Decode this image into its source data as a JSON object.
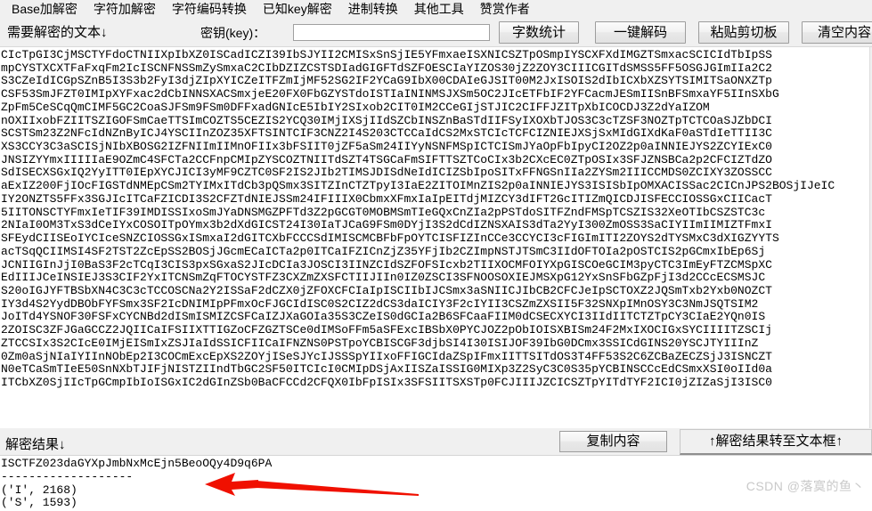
{
  "menubar": {
    "items": [
      {
        "label": "Base加解密"
      },
      {
        "label": "字符加解密"
      },
      {
        "label": "字符编码转换"
      },
      {
        "label": "已知key解密"
      },
      {
        "label": "进制转换"
      },
      {
        "label": "其他工具"
      },
      {
        "label": "赞赏作者"
      }
    ]
  },
  "toolbar": {
    "source_label": "需要解密的文本↓",
    "key_label": "密钥(key)：",
    "key_value": "",
    "key_placeholder": "",
    "count_button": "字数统计",
    "decode_button": "一键解码",
    "paste_button": "粘贴剪切板",
    "clear_button": "清空内容"
  },
  "source_text": {
    "lines": [
      "CIcTpGI3CjMSCTYFdoCTNIIXpIbXZ0ISCadICZI39IbSJYII2CMISxSnSjIE5YFmxaeISXNICSZTpOSmpIYSCXFXdIMGZTSmxacSCICIdTbIpSS",
      "mpCYSTXCXTFaFxqFm2IcISCNFNSSmZySmxaC2CIbDZIZCSTSDIadGIGFTdSZFOESCIaYIZOS30jZ2ZOY3CIIICGITdSMSS5FF5OSGJGImIIa2C2",
      "S3CZeIdICGpSZnB5I3S3b2FyI3djZIpXYICZeITFZmIjMF52SG2IF2YCaG9IbX00CDAIeGJSIT00M2JxISOIS2dIbICXbXZSYTSIMITSaONXZTp",
      "CSF53SmJFZT0IMIpXYFxac2dCbINNSXACSmxjeE20FX0FbGZYSTdoISTIaININMSJXSm5OC2JIcETFbIF2YFCacmJESmIISnBFSmxaYF5IInSXbG",
      "ZpFm5CeSCqQmCIMF5GC2CoaSJFSm9FSm0DFFxadGNIcE5IbIY2SIxob2CIT0IM2CCeGIjSTJIC2CIFFJZITpXbICOCDJ3Z2dYaIZOM",
      "nOXIIxobFZIITSZIGOFSmCaeTTSImCOZTS5CEZIS2YCQ30IMjIXSjIIdSZCbINSZnBaSTdIIFSyIXOXbTJOS3C3cTZSF3NOZTpTCTCOaSJZbDCI",
      "SCSTSm23Z2NFcIdNZnByICJ4YSCIInZOZ35XFTSINTCIF3CNZ2I4S203CTCCaIdCS2MxSTCIcTCFCIZNIEJXSjSxMIdGIXdKaF0aSTdIeTTII3C",
      "XS3CCY3C3aSCISjNIbXBOSG2IZFNIImIIMnOFIIx3bFSIIT0jZF5aSm24IIYyNSNFMSpICTCISmJYaOpFbIpyCI2OZ2p0aINNIEJYS2ZCYIExC0",
      "JNSIZYYmxIIIIIaE9OZmC4SFCTa2CCFnpCMIpZYSCOZTNIITdSZT4TSGCaFmSIFTTSZTCoCIx3b2CXcEC0ZTpOSIx3SFJZNSBCa2p2CFCIZTdZO",
      "SdISECXSGxIQ2YyITT0IEpXYCJICI3yMF9CZTC0SF2IS2JIb2TIMSJDISdNeIdICIZSbIpoSITxFFNGSnIIa2ZYSm2IIICCMDS0ZCIXY3ZOSSCC",
      "aExIZ200FjIOcFIGSTdNMEpCSm2TYIMxITdCb3pQSmx3SITZInCTZTpyI3IaE2ZITOIMnZIS2p0aINNIEJYS3ISISbIpOMXACISSac2CICnJPS2BOSjIJeIC",
      "IY2ONZTS5FFx3SGJIcITCaFZICDI3S2CFZTdNIEJSSm24IFIIIX0CbmxXFmxIaIpEITdjMIZCY3dIFT2GcITIZmQICDJISFECCIOSSGxCIICacT",
      "5IITONSCTYFmxIeTIF39IMDISSIxoSmJYaDNSMGZPFTd3Z2pGCGT0MOBMSmTIeGQxCnZIa2pPSTdoSITFZndFMSpTCSZIS32XeOTIbCSZSTC3c",
      "2NIaI0OM3TxS3dCeIYxCOSOITpOYmx3b2dXdGICST24I30IaTJCaG9FSm0DYjI3S2dCdIZNSXAIS3dTa2YyI300ZmOSS3SaCIYIImIIMIZTFmxI",
      "SFEydCIISEoIYCIceSNZCIOSSGxISmxaI2dGITCXbFCCCSdIMISCMCBFbFpOYTCISFIZInCCe3CCYCI3cFIGImITI2ZOYS2dTYSMxC3dXIGZYYTS",
      "acTSqQCIIMSI4SF2TST2ZcEpSS2BOSjJGcmECaICTa2p0ITCaIFZICnZjZ35YFjIb2CZImpNSTJTSmC3IIdOFTOIa2pOSTCIS2pGCmxIbEp6Sj",
      "JCNIIGInJjI0BaS3F2cTCqI3CIS3pxSGxaS2JIcDCIa3JOSCI3IINZCIdSZFOFSIcxb2TIIXOCMFOIYXpGISCOeGCIM3pyCTC3ImEyFTZCMSpXC",
      "EdIIIJCeINSIEJ3S3CIF2YxITCNSmZqFTOCYSTFZ3CXZmZXSFCTIIJIIn0IZ0ZSCI3SFNOOSOXIEJMSXpG12YxSnSFbGZpFjI3d2CCcECSMSJC",
      "S20oIGJYFTBSbXN4C3C3cTCCOSCNa2Y2ISSaF2dCZX0jZFOXCFCIaIpISCIIbIJCSmx3aSNIICJIbCB2CFCJeIpSCTOXZ2JQSmTxb2Yxb0NOZCT",
      "IY3d4S2YydDBObFYFSmx3SF2IcDNIMIpPFmxOcFJGCIdISC0S2CIZ2dCS3daICIY3F2cIYII3CSZmZXSII5F32SNXpIMnOSY3C3NmJSQTSIM2",
      "JoITd4YSNOF30FSFxCYCNBd2dISmISMIZCSFCaIZJXaGOIa35S3CZeIS0dGCIa2B6SFCaaFIIM0dCSECXYCI3IIdIITCTZTpCY3CIaE2YQn0IS",
      "2ZOISC3ZFJGaGCCZ2JQIICaIFSIIXTTIGZoCFZGZTSCe0dIMSoFFm5aSFExcIBSbX0PYCJOZ2pObIOISXBISm24F2MxIXOCIGxSYCIIIITZSCIj",
      "ZTCCSIx3S2CIcE0IMjEISmIxZSJIaIdSSICFIICaIFNZNS0PSTpoYCBISCGF3djbSI4I30ISIJOF39IbG0DCmx3SSICdGINS20YSCJTYIIInZ",
      "0Zm0aSjNIaIYIInNObEp2I3COCmExcEpXS2ZOYjISeSJYcIJSSSpYIIxoFFIGCIdaZSpIFmxIITTSITdOS3T4FF53S2C6ZCBaZECZSjJ3ISNCZT",
      "N0eTCaSmTIeE50SnNXbTJIFjNISTZIIndTbGC2SF50ITCIcI0CMIpDSjAxIISZaISSIG0MIXp3Z2SyC3C0S35pYCBINSCCcEdCSmxXSI0oIId0a",
      "ITCbXZ0SjIIcTpGCmpIbIoISGxIC2dGInZSb0BaCFCCd2CFQX0IbFpISIx3SFSIITSXSTp0FCJIIIJZCICSZTpYITdTYF2ICI0jZIZaSjI3ISC0"
    ]
  },
  "result_bar": {
    "result_label": "解密结果↓",
    "copy_button": "复制内容",
    "to_textbox_button": "↑解密结果转至文本框↑"
  },
  "result_text": {
    "lines": [
      "ISCTFZ023daGYXpJmbNxMcEjn5BeoOQy4D9q6PA",
      "-------------------",
      "('I', 2168)",
      "('S', 1593)"
    ]
  },
  "annotation": {
    "arrow_color": "#f01000"
  },
  "watermark": {
    "text": "CSDN @落寞的鱼丶"
  }
}
